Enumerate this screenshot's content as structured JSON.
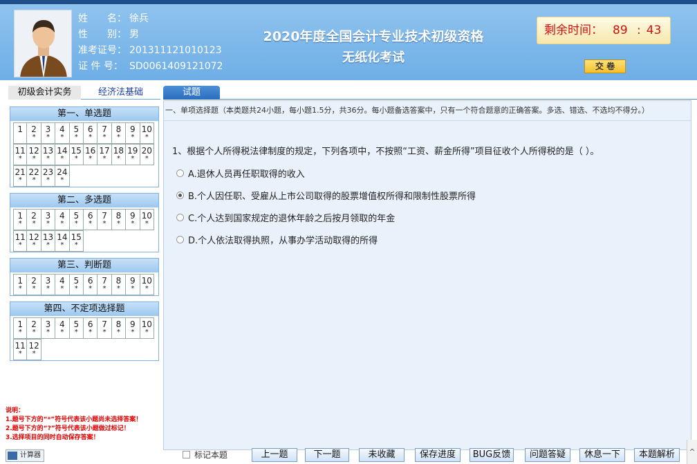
{
  "candidate": {
    "name_label": "姓　　名：",
    "name": "徐兵",
    "gender_label": "性　　别：",
    "gender": "男",
    "ticket_label": "准考证号：",
    "ticket": "201311121010123",
    "id_label": "证 件 号：",
    "id": "SD0061409121072"
  },
  "exam": {
    "title_line1": "2020年度全国会计专业技术初级资格",
    "title_line2": "无纸化考试"
  },
  "timer": {
    "label": "剩余时间：",
    "minutes": "89",
    "sep": ":",
    "seconds": "43"
  },
  "submit_label": "交  卷",
  "subjects": {
    "active": "初级会计实务",
    "inactive": "经济法基础"
  },
  "sections": [
    {
      "title": "第一、单选题",
      "count": 24
    },
    {
      "title": "第二、多选题",
      "count": 15
    },
    {
      "title": "第三、判断题",
      "count": 10
    },
    {
      "title": "第四、不定项选择题",
      "count": 12
    }
  ],
  "star_mark": "*",
  "notes": {
    "title": "说明：",
    "line1": "1.题号下方的“*”符号代表该小题尚未选择答案！",
    "line2": "2.题号下方的“?”符号代表该小题做过标记！",
    "line3": "3.选择项目的同时自动保存答案！"
  },
  "calculator_label": "计算器",
  "main_tab": "试题",
  "instruction": "一、单项选择题（本类题共24小题，每小题1.5分，共36分。每小题备选答案中，只有一个符合题意的正确答案。多选、错选、不选均不得分。）",
  "question": {
    "text": "1、根据个人所得税法律制度的规定，下列各项中，不按照“工资、薪金所得”项目征收个人所得税的是（ ）。",
    "options": [
      {
        "label": "A.退休人员再任职取得的收入",
        "selected": false
      },
      {
        "label": "B.个人因任职、受雇从上市公司取得的股票增值权所得和限制性股票所得",
        "selected": true
      },
      {
        "label": "C.个人达到国家规定的退休年龄之后按月领取的年金",
        "selected": false
      },
      {
        "label": "D.个人依法取得执照，从事办学活动取得的所得",
        "selected": false
      }
    ]
  },
  "bottom": {
    "mark_label": "标记本题",
    "prev": "上一题",
    "next": "下一题",
    "unfav": "未收藏",
    "save": "保存进度",
    "bug": "BUG反馈",
    "qa": "问题答疑",
    "rest": "休息一下",
    "analysis": "本题解析"
  },
  "scroll_glyph": "^"
}
